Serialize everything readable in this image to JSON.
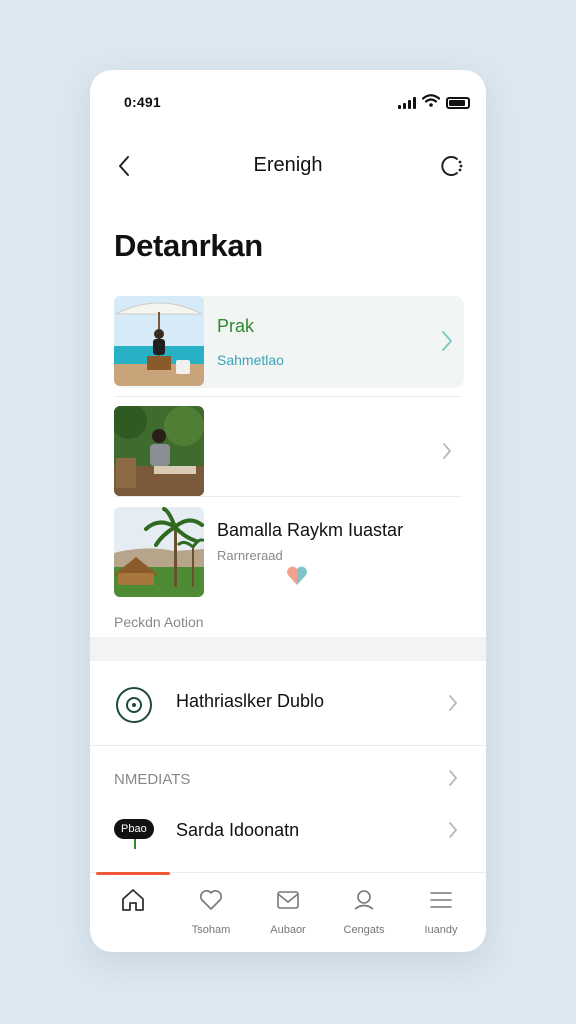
{
  "status": {
    "time": "0:491"
  },
  "nav": {
    "title": "Erenigh"
  },
  "page": {
    "title": "Detanrkan"
  },
  "items": [
    {
      "title": "Prak",
      "subtitle": "Sahmetlao",
      "title_color": "#2e8b2e",
      "subtitle_color": "#3aa4b8",
      "selected": true
    },
    {
      "title": "",
      "subtitle": "",
      "selected": false
    },
    {
      "title": "Bamalla Raykm Iuastar",
      "subtitle": "Rarnreraad",
      "selected": false
    }
  ],
  "section": {
    "label": "Peckdn Aotion"
  },
  "rows": [
    {
      "label": "Hathriaslker Dublo",
      "icon": "target-icon"
    },
    {
      "label": "NMEDIATS"
    },
    {
      "label": "Sarda Idoonatn",
      "badge": "Pbao"
    }
  ],
  "tabs": [
    {
      "label": "",
      "icon": "home-icon",
      "active": true
    },
    {
      "label": "Tsoham",
      "icon": "heart-icon"
    },
    {
      "label": "Aubaor",
      "icon": "mail-icon"
    },
    {
      "label": "Cengats",
      "icon": "user-icon"
    },
    {
      "label": "Iuandy",
      "icon": "menu-icon"
    }
  ],
  "colors": {
    "accent": "#f05a3a",
    "selected_bg": "#f1f5f4",
    "chevron_active": "#7ccbc0"
  }
}
